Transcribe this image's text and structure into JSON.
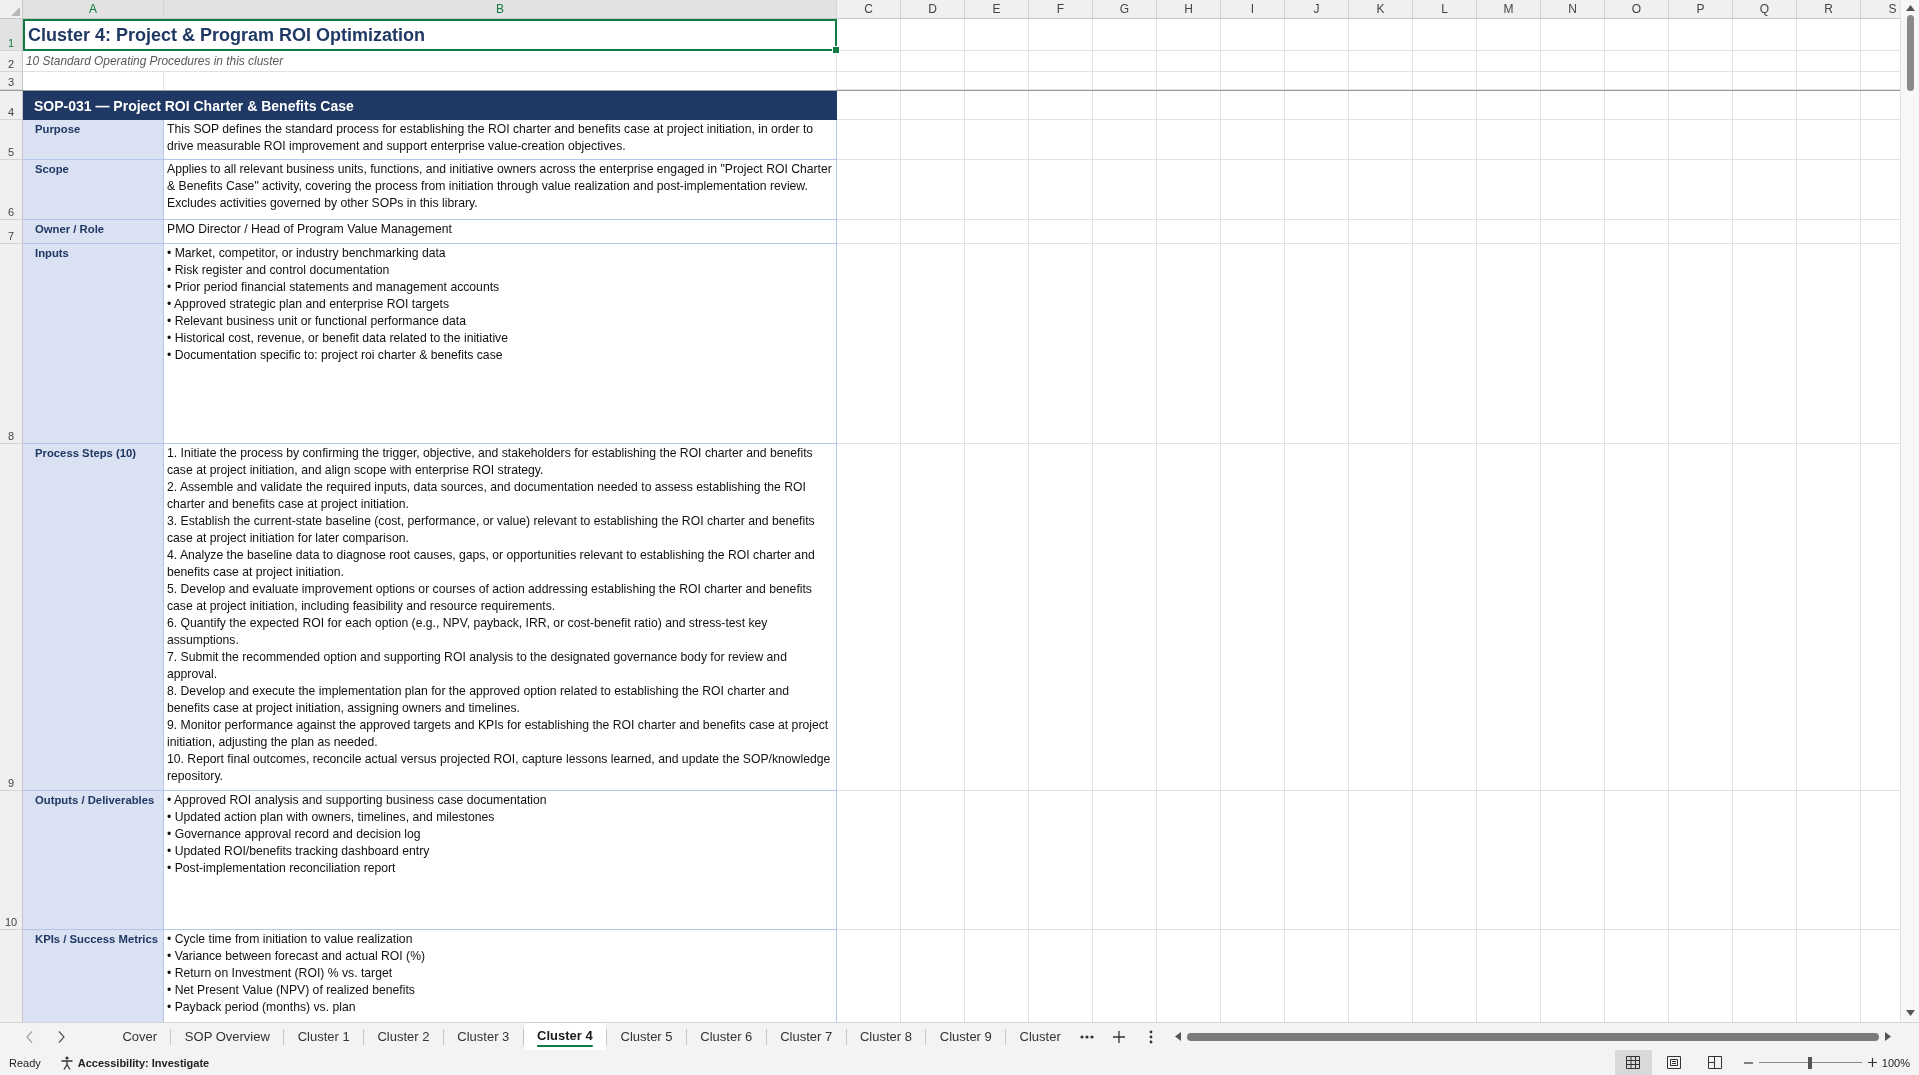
{
  "columns": [
    {
      "label": "A",
      "selected": true
    },
    {
      "label": "B",
      "selected": true
    },
    {
      "label": "C",
      "selected": false
    },
    {
      "label": "D",
      "selected": false
    },
    {
      "label": "E",
      "selected": false
    },
    {
      "label": "F",
      "selected": false
    },
    {
      "label": "G",
      "selected": false
    },
    {
      "label": "H",
      "selected": false
    },
    {
      "label": "I",
      "selected": false
    },
    {
      "label": "J",
      "selected": false
    },
    {
      "label": "K",
      "selected": false
    },
    {
      "label": "L",
      "selected": false
    },
    {
      "label": "M",
      "selected": false
    },
    {
      "label": "N",
      "selected": false
    },
    {
      "label": "O",
      "selected": false
    },
    {
      "label": "P",
      "selected": false
    },
    {
      "label": "Q",
      "selected": false
    },
    {
      "label": "R",
      "selected": false
    },
    {
      "label": "S",
      "selected": false
    }
  ],
  "row_numbers": [
    {
      "label": "1",
      "selected": true
    },
    {
      "label": "2",
      "selected": false
    },
    {
      "label": "3",
      "selected": false
    },
    {
      "label": "4",
      "selected": false
    },
    {
      "label": "5",
      "selected": false
    },
    {
      "label": "6",
      "selected": false
    },
    {
      "label": "7",
      "selected": false
    },
    {
      "label": "8",
      "selected": false
    },
    {
      "label": "9",
      "selected": false
    },
    {
      "label": "10",
      "selected": false
    }
  ],
  "sheet": {
    "title": {
      "text": "Cluster 4: Project & Program ROI Optimization",
      "selected": true
    },
    "subtitle": "10 Standard Operating Procedures in this cluster",
    "sop_heading": "SOP-031 — Project ROI Charter & Benefits Case",
    "fields": [
      {
        "label": "Purpose",
        "kind": "text",
        "value": "This SOP defines the standard process for establishing the ROI charter and benefits case at project initiation, in order to drive measurable ROI improvement and support enterprise value-creation objectives."
      },
      {
        "label": "Scope",
        "kind": "text",
        "value": "Applies to all relevant business units, functions, and initiative owners across the enterprise engaged in \"Project ROI Charter & Benefits Case\" activity, covering the process from initiation through value realization and post-implementation review. Excludes activities governed by other SOPs in this library."
      },
      {
        "label": "Owner / Role",
        "kind": "text",
        "value": "PMO Director / Head of Program Value Management"
      },
      {
        "label": "Inputs",
        "kind": "list",
        "items": [
          "• Market, competitor, or industry benchmarking data",
          "• Risk register and control documentation",
          "• Prior period financial statements and management accounts",
          "• Approved strategic plan and enterprise ROI targets",
          "• Relevant business unit or functional performance data",
          "• Historical cost, revenue, or benefit data related to the initiative",
          "• Documentation specific to: project roi charter & benefits case"
        ]
      },
      {
        "label": "Process Steps (10)",
        "kind": "list",
        "items": [
          "1. Initiate the process by confirming the trigger, objective, and stakeholders for establishing the ROI charter and benefits case at project initiation, and align scope with enterprise ROI strategy.",
          "2. Assemble and validate the required inputs, data sources, and documentation needed to assess establishing the ROI charter and benefits case at project initiation.",
          "3. Establish the current-state baseline (cost, performance, or value) relevant to establishing the ROI charter and benefits case at project initiation for later comparison.",
          "4. Analyze the baseline data to diagnose root causes, gaps, or opportunities relevant to establishing the ROI charter and benefits case at project initiation.",
          "5. Develop and evaluate improvement options or courses of action addressing establishing the ROI charter and benefits case at project initiation, including feasibility and resource requirements.",
          "6. Quantify the expected ROI for each option (e.g., NPV, payback, IRR, or cost-benefit ratio) and stress-test key assumptions.",
          "7. Submit the recommended option and supporting ROI analysis to the designated governance body for review and approval.",
          "8. Develop and execute the implementation plan for the approved option related to establishing the ROI charter and benefits case at project initiation, assigning owners and timelines.",
          "9. Monitor performance against the approved targets and KPIs for establishing the ROI charter and benefits case at project initiation, adjusting the plan as needed.",
          "10. Report final outcomes, reconcile actual versus projected ROI, capture lessons learned, and update the SOP/knowledge repository."
        ]
      },
      {
        "label": "Outputs / Deliverables",
        "kind": "list",
        "items": [
          "• Approved ROI analysis and supporting business case documentation",
          "• Updated action plan with owners, timelines, and milestones",
          "• Governance approval record and decision log",
          "• Updated ROI/benefits tracking dashboard entry",
          "• Post-implementation reconciliation report"
        ]
      },
      {
        "label": "KPIs / Success Metrics",
        "kind": "list",
        "items": [
          "• Cycle time from initiation to value realization",
          "• Variance between forecast and actual ROI (%)",
          "• Return on Investment (ROI) % vs. target",
          "• Net Present Value (NPV) of realized benefits",
          "• Payback period (months) vs. plan"
        ]
      }
    ]
  },
  "sheet_tabs": [
    {
      "label": "Cover",
      "selected": false
    },
    {
      "label": "SOP Overview",
      "selected": false
    },
    {
      "label": "Cluster 1",
      "selected": false
    },
    {
      "label": "Cluster 2",
      "selected": false
    },
    {
      "label": "Cluster 3",
      "selected": false
    },
    {
      "label": "Cluster 4",
      "selected": true
    },
    {
      "label": "Cluster 5",
      "selected": false
    },
    {
      "label": "Cluster 6",
      "selected": false
    },
    {
      "label": "Cluster 7",
      "selected": false
    },
    {
      "label": "Cluster 8",
      "selected": false
    },
    {
      "label": "Cluster 9",
      "selected": false
    },
    {
      "label": "Cluster",
      "selected": false
    }
  ],
  "status_bar": {
    "status": "Ready",
    "accessibility": "Accessibility: Investigate",
    "views": [
      {
        "kind": "normal",
        "selected": true
      },
      {
        "kind": "page_layout",
        "selected": false
      },
      {
        "kind": "page_break",
        "selected": false
      }
    ],
    "zoom": {
      "level": 0.5,
      "reading": "100%"
    }
  }
}
